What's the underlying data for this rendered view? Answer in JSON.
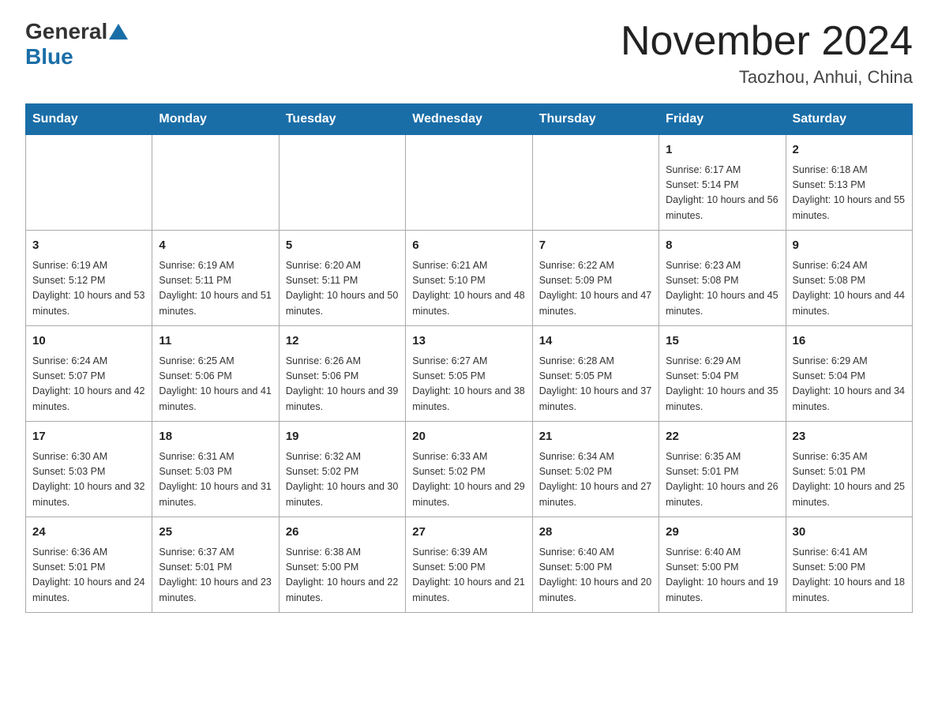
{
  "header": {
    "logo_general": "General",
    "logo_blue": "Blue",
    "month_year": "November 2024",
    "location": "Taozhou, Anhui, China"
  },
  "days_of_week": [
    "Sunday",
    "Monday",
    "Tuesday",
    "Wednesday",
    "Thursday",
    "Friday",
    "Saturday"
  ],
  "weeks": [
    {
      "days": [
        {
          "number": "",
          "info": ""
        },
        {
          "number": "",
          "info": ""
        },
        {
          "number": "",
          "info": ""
        },
        {
          "number": "",
          "info": ""
        },
        {
          "number": "",
          "info": ""
        },
        {
          "number": "1",
          "info": "Sunrise: 6:17 AM\nSunset: 5:14 PM\nDaylight: 10 hours and 56 minutes."
        },
        {
          "number": "2",
          "info": "Sunrise: 6:18 AM\nSunset: 5:13 PM\nDaylight: 10 hours and 55 minutes."
        }
      ]
    },
    {
      "days": [
        {
          "number": "3",
          "info": "Sunrise: 6:19 AM\nSunset: 5:12 PM\nDaylight: 10 hours and 53 minutes."
        },
        {
          "number": "4",
          "info": "Sunrise: 6:19 AM\nSunset: 5:11 PM\nDaylight: 10 hours and 51 minutes."
        },
        {
          "number": "5",
          "info": "Sunrise: 6:20 AM\nSunset: 5:11 PM\nDaylight: 10 hours and 50 minutes."
        },
        {
          "number": "6",
          "info": "Sunrise: 6:21 AM\nSunset: 5:10 PM\nDaylight: 10 hours and 48 minutes."
        },
        {
          "number": "7",
          "info": "Sunrise: 6:22 AM\nSunset: 5:09 PM\nDaylight: 10 hours and 47 minutes."
        },
        {
          "number": "8",
          "info": "Sunrise: 6:23 AM\nSunset: 5:08 PM\nDaylight: 10 hours and 45 minutes."
        },
        {
          "number": "9",
          "info": "Sunrise: 6:24 AM\nSunset: 5:08 PM\nDaylight: 10 hours and 44 minutes."
        }
      ]
    },
    {
      "days": [
        {
          "number": "10",
          "info": "Sunrise: 6:24 AM\nSunset: 5:07 PM\nDaylight: 10 hours and 42 minutes."
        },
        {
          "number": "11",
          "info": "Sunrise: 6:25 AM\nSunset: 5:06 PM\nDaylight: 10 hours and 41 minutes."
        },
        {
          "number": "12",
          "info": "Sunrise: 6:26 AM\nSunset: 5:06 PM\nDaylight: 10 hours and 39 minutes."
        },
        {
          "number": "13",
          "info": "Sunrise: 6:27 AM\nSunset: 5:05 PM\nDaylight: 10 hours and 38 minutes."
        },
        {
          "number": "14",
          "info": "Sunrise: 6:28 AM\nSunset: 5:05 PM\nDaylight: 10 hours and 37 minutes."
        },
        {
          "number": "15",
          "info": "Sunrise: 6:29 AM\nSunset: 5:04 PM\nDaylight: 10 hours and 35 minutes."
        },
        {
          "number": "16",
          "info": "Sunrise: 6:29 AM\nSunset: 5:04 PM\nDaylight: 10 hours and 34 minutes."
        }
      ]
    },
    {
      "days": [
        {
          "number": "17",
          "info": "Sunrise: 6:30 AM\nSunset: 5:03 PM\nDaylight: 10 hours and 32 minutes."
        },
        {
          "number": "18",
          "info": "Sunrise: 6:31 AM\nSunset: 5:03 PM\nDaylight: 10 hours and 31 minutes."
        },
        {
          "number": "19",
          "info": "Sunrise: 6:32 AM\nSunset: 5:02 PM\nDaylight: 10 hours and 30 minutes."
        },
        {
          "number": "20",
          "info": "Sunrise: 6:33 AM\nSunset: 5:02 PM\nDaylight: 10 hours and 29 minutes."
        },
        {
          "number": "21",
          "info": "Sunrise: 6:34 AM\nSunset: 5:02 PM\nDaylight: 10 hours and 27 minutes."
        },
        {
          "number": "22",
          "info": "Sunrise: 6:35 AM\nSunset: 5:01 PM\nDaylight: 10 hours and 26 minutes."
        },
        {
          "number": "23",
          "info": "Sunrise: 6:35 AM\nSunset: 5:01 PM\nDaylight: 10 hours and 25 minutes."
        }
      ]
    },
    {
      "days": [
        {
          "number": "24",
          "info": "Sunrise: 6:36 AM\nSunset: 5:01 PM\nDaylight: 10 hours and 24 minutes."
        },
        {
          "number": "25",
          "info": "Sunrise: 6:37 AM\nSunset: 5:01 PM\nDaylight: 10 hours and 23 minutes."
        },
        {
          "number": "26",
          "info": "Sunrise: 6:38 AM\nSunset: 5:00 PM\nDaylight: 10 hours and 22 minutes."
        },
        {
          "number": "27",
          "info": "Sunrise: 6:39 AM\nSunset: 5:00 PM\nDaylight: 10 hours and 21 minutes."
        },
        {
          "number": "28",
          "info": "Sunrise: 6:40 AM\nSunset: 5:00 PM\nDaylight: 10 hours and 20 minutes."
        },
        {
          "number": "29",
          "info": "Sunrise: 6:40 AM\nSunset: 5:00 PM\nDaylight: 10 hours and 19 minutes."
        },
        {
          "number": "30",
          "info": "Sunrise: 6:41 AM\nSunset: 5:00 PM\nDaylight: 10 hours and 18 minutes."
        }
      ]
    }
  ]
}
